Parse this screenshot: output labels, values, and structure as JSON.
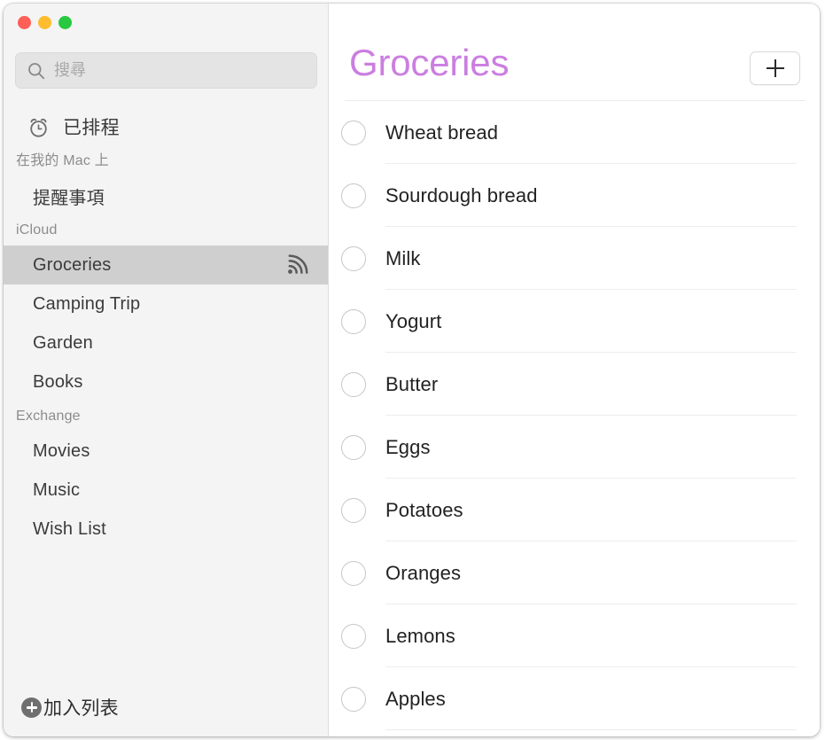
{
  "window": {
    "traffic_lights": [
      {
        "name": "close",
        "color": "#ff5f57"
      },
      {
        "name": "minimize",
        "color": "#febc2e"
      },
      {
        "name": "zoom",
        "color": "#28c840"
      }
    ]
  },
  "sidebar": {
    "search": {
      "placeholder": "搜尋",
      "value": "",
      "icon": "search-icon"
    },
    "smart_lists": [
      {
        "label": "已排程",
        "icon": "alarm-clock-icon"
      }
    ],
    "sections": [
      {
        "header": "在我的 Mac 上",
        "items": [
          {
            "label": "提醒事項",
            "selected": false,
            "shared": false
          }
        ]
      },
      {
        "header": "iCloud",
        "items": [
          {
            "label": "Groceries",
            "selected": true,
            "shared": true
          },
          {
            "label": "Camping Trip",
            "selected": false,
            "shared": false
          },
          {
            "label": "Garden",
            "selected": false,
            "shared": false
          },
          {
            "label": "Books",
            "selected": false,
            "shared": false
          }
        ]
      },
      {
        "header": "Exchange",
        "items": [
          {
            "label": "Movies",
            "selected": false,
            "shared": false
          },
          {
            "label": "Music",
            "selected": false,
            "shared": false
          },
          {
            "label": "Wish List",
            "selected": false,
            "shared": false
          }
        ]
      }
    ],
    "add_list": {
      "label": "加入列表",
      "icon": "plus-circle-icon"
    }
  },
  "content": {
    "title": "Groceries",
    "title_color": "#cb7ee0",
    "add_reminder": {
      "icon": "plus-icon",
      "label": ""
    },
    "reminders": [
      {
        "label": "Wheat bread",
        "completed": false
      },
      {
        "label": "Sourdough bread",
        "completed": false
      },
      {
        "label": "Milk",
        "completed": false
      },
      {
        "label": "Yogurt",
        "completed": false
      },
      {
        "label": "Butter",
        "completed": false
      },
      {
        "label": "Eggs",
        "completed": false
      },
      {
        "label": "Potatoes",
        "completed": false
      },
      {
        "label": "Oranges",
        "completed": false
      },
      {
        "label": "Lemons",
        "completed": false
      },
      {
        "label": "Apples",
        "completed": false
      }
    ]
  }
}
